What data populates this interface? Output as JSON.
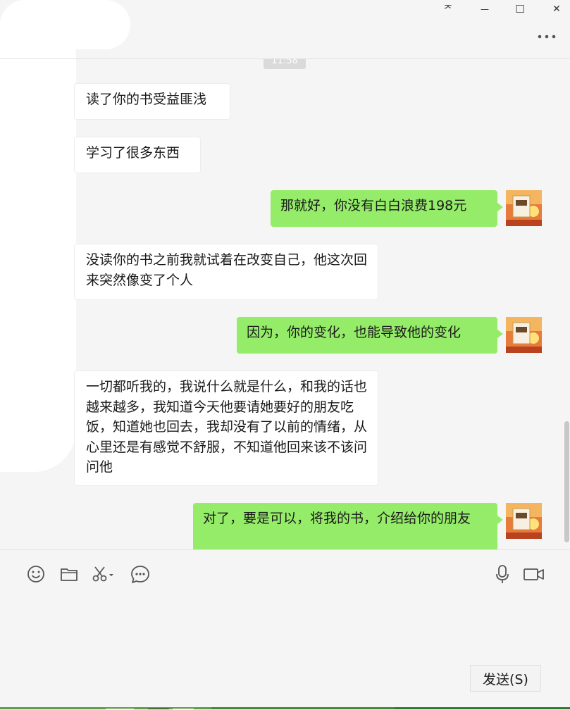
{
  "window": {
    "pin_glyph": "ᅎ",
    "minimize_glyph": "—",
    "maximize_glyph": "☐",
    "close_glyph": "✕",
    "more_icon": "more-dots-icon"
  },
  "timestamp": "11:58",
  "messages": [
    {
      "side": "in",
      "text": "读了你的书受益匪浅"
    },
    {
      "side": "in",
      "text": "学习了很多东西"
    },
    {
      "side": "out",
      "text": "那就好，你没有白白浪费198元"
    },
    {
      "side": "in",
      "text": "没读你的书之前我就试着在改变自己，他这次回来突然像变了个人"
    },
    {
      "side": "out",
      "text": "因为，你的变化，也能导致他的变化"
    },
    {
      "side": "in",
      "text": "一切都听我的，我说什么就是什么，和我的话也越来越多，我知道今天他要请她要好的朋友吃饭，知道她也回去，我却没有了以前的情绪，从心里还是有感觉不舒服，不知道他回来该不该问问他"
    },
    {
      "side": "out",
      "text": "对了，要是可以，将我的书，介绍给你的朋友"
    }
  ],
  "toolbar": {
    "emoji_icon": "emoji-icon",
    "folder_icon": "folder-icon",
    "screenshot_icon": "scissors-icon",
    "chat_history_icon": "chat-bubble-icon",
    "voice_icon": "microphone-icon",
    "video_icon": "video-camera-icon"
  },
  "send_label": "发送(S)",
  "colors": {
    "chat_bg": "#f5f5f5",
    "bubble_in": "#ffffff",
    "bubble_out": "#95ec69",
    "scrollbar": "#c8c8c8"
  }
}
